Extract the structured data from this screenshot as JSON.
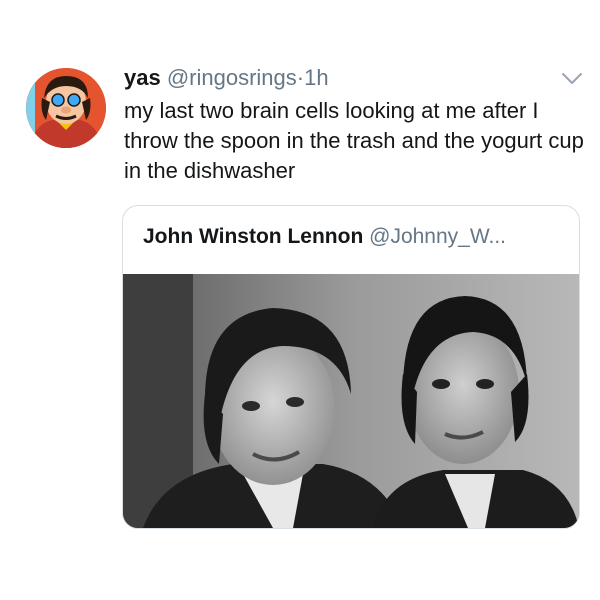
{
  "tweet": {
    "display_name": "yas",
    "handle": "@ringosrings",
    "separator": "·",
    "time": "1h",
    "text": "my last two brain cells looking at me after I throw the spoon in the trash and the yogurt cup in the dishwasher",
    "avatar_icon": "cartoon-avatar",
    "menu_icon": "chevron-down-icon"
  },
  "quote": {
    "display_name": "John Winston Lennon",
    "handle": "@Johnny_W...",
    "media": "black-and-white-photo-two-men"
  },
  "colors": {
    "text": "#14171a",
    "secondary_text": "#657786",
    "border": "#d8dfe4",
    "background": "#ffffff"
  }
}
